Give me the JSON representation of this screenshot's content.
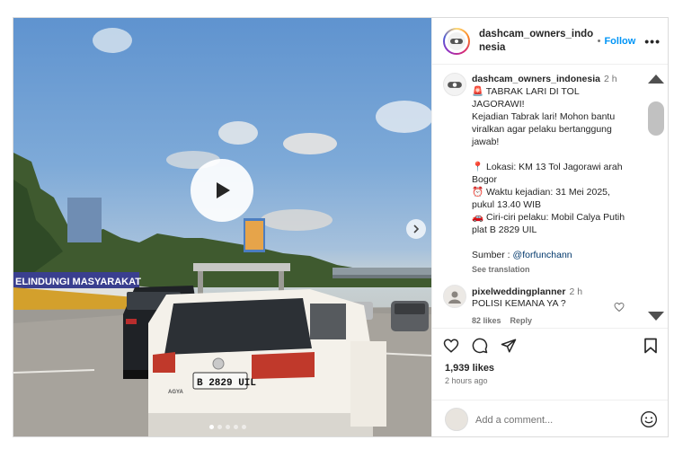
{
  "account": {
    "username": "dashcam_owners_indonesia",
    "follow_label": "Follow",
    "dot": "•",
    "more_label": "•••"
  },
  "post": {
    "username": "dashcam_owners_indonesia",
    "time": "2 h",
    "caption": "🚨 TABRAK LARI DI TOL JAGORAWI!\nKejadian Tabrak lari! Mohon bantu viralkan agar pelaku bertanggung jawab!\n\n📍 Lokasi: KM 13 Tol Jagorawi arah Bogor\n⏰ Waktu kejadian: 31 Mei 2025, pukul 13.40 WIB\n🚗 Ciri-ciri pelaku: Mobil Calya Putih plat B 2829 UIL\n\nSumber : ",
    "mention": "@forfunchann",
    "see_translation": "See translation"
  },
  "comment": {
    "username": "pixelweddingplanner",
    "time": "2 h",
    "text": "POLISI KEMANA YA ?",
    "likes": "82 likes",
    "reply": "Reply"
  },
  "stats": {
    "likes": "1,939 likes",
    "ago": "2 hours ago"
  },
  "add_comment": {
    "placeholder": "Add a comment..."
  },
  "media": {
    "banner_text": "ELINDUNGI MASYARAKAT",
    "plate_text": "B 2829 UIL",
    "brand_text": "AGYA"
  },
  "icons": {
    "play": "play-icon",
    "next": "chevron-right-icon",
    "like": "heart-icon",
    "comment": "comment-icon",
    "share": "share-icon",
    "save": "bookmark-icon",
    "emoji": "smiley-icon",
    "scroll_up": "triangle-up-icon",
    "scroll_down": "triangle-down-icon"
  }
}
